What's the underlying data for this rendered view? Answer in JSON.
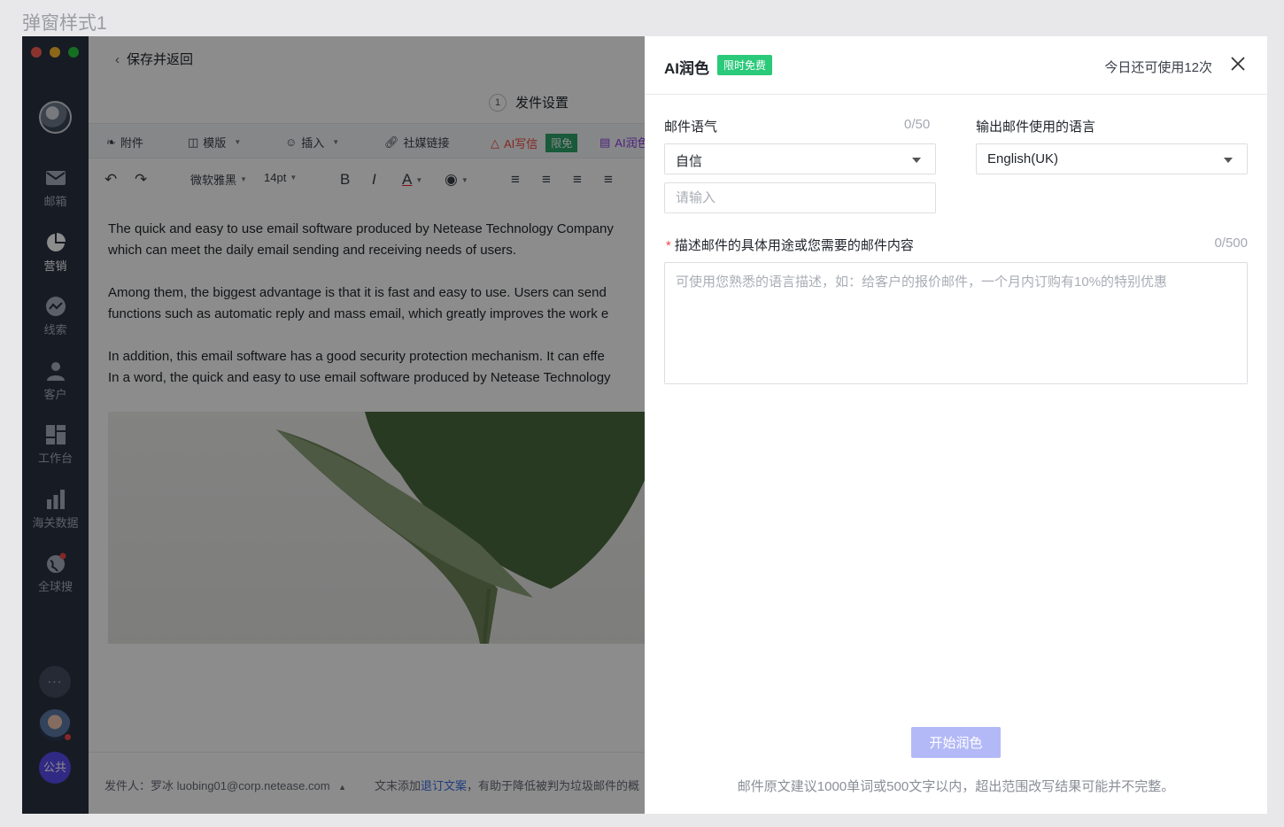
{
  "frame_label": "弹窗样式1",
  "sidebar": {
    "items": [
      {
        "label": "邮箱",
        "icon": "mail-icon"
      },
      {
        "label": "营销",
        "icon": "pie-chart-icon"
      },
      {
        "label": "线索",
        "icon": "trend-icon"
      },
      {
        "label": "客户",
        "icon": "person-icon"
      },
      {
        "label": "工作台",
        "icon": "dashboard-icon"
      },
      {
        "label": "海关数据",
        "icon": "bar-chart-icon"
      },
      {
        "label": "全球搜",
        "icon": "globe-icon"
      }
    ],
    "active": "营销",
    "more_label": "···",
    "public_label": "公共"
  },
  "editor": {
    "back_label": "保存并返回",
    "step_num": "1",
    "step_label": "发件设置",
    "toolbar": {
      "attach": "附件",
      "template": "模版",
      "insert": "插入",
      "social": "社媒链接",
      "ai_write": "AI写信",
      "free_badge": "限免",
      "ai_polish": "AI润色"
    },
    "format": {
      "font": "微软雅黑",
      "size": "14pt",
      "bold": "B",
      "italic": "I",
      "color": "A"
    },
    "paragraphs": [
      "The quick and easy to use email software produced by Netease Technology Company",
      "which can meet the daily email sending and receiving needs of users.",
      "Among them, the biggest advantage is that it is fast and easy to use. Users can send",
      "functions such as automatic reply and mass email, which greatly improves the work e",
      "In addition, this email software has a good security protection mechanism. It can effe",
      "In a word, the quick and easy to use email software produced by Netease Technology"
    ],
    "footer_sender_prefix": "发件人：",
    "footer_sender": "罗冰 luobing01@corp.netease.com",
    "footer_tip_prefix": "文末添加",
    "footer_tip_link": "退订文案",
    "footer_tip_suffix": "，有助于降低被判为垃圾邮件的概"
  },
  "panel": {
    "title": "AI润色",
    "badge": "限时免费",
    "remaining": "今日还可使用12次",
    "tone_label": "邮件语气",
    "tone_count": "0/50",
    "tone_value": "自信",
    "tone_input_placeholder": "请输入",
    "lang_label": "输出邮件使用的语言",
    "lang_value": "English(UK)",
    "desc_required": "*",
    "desc_label": "描述邮件的具体用途或您需要的邮件内容",
    "desc_count": "0/500",
    "desc_placeholder": "可使用您熟悉的语言描述，如：给客户的报价邮件，一个月内订购有10%的特别优惠",
    "start_button": "开始润色",
    "note": "邮件原文建议1000单词或500文字以内，超出范围改写结果可能并不完整。"
  },
  "colors": {
    "sidebar_bg": "#2b3243",
    "accent": "#5a4df0",
    "badge_green": "#2bc97a",
    "button_disabled": "#b3b9f7"
  }
}
